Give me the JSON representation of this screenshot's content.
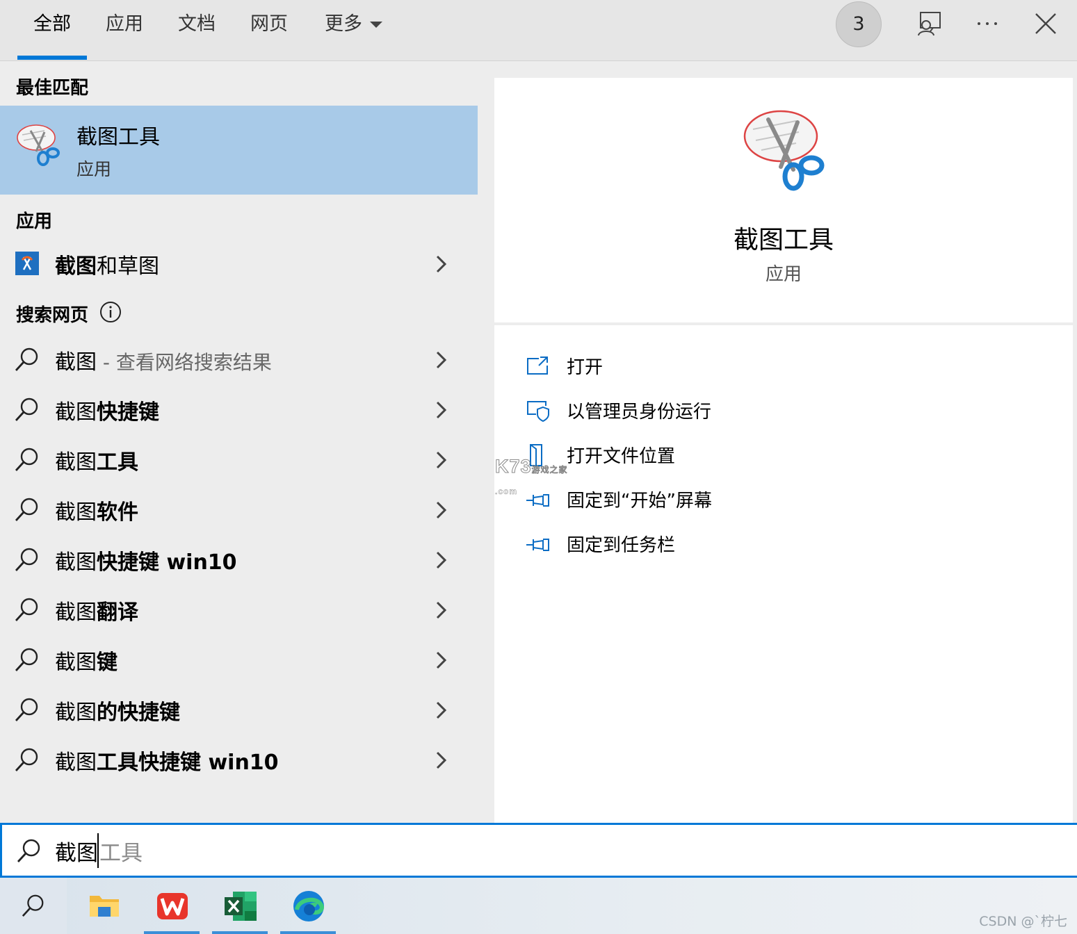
{
  "tabs": [
    {
      "label": "全部",
      "active": true
    },
    {
      "label": "应用",
      "active": false
    },
    {
      "label": "文档",
      "active": false
    },
    {
      "label": "网页",
      "active": false
    },
    {
      "label": "更多",
      "active": false
    }
  ],
  "header_tools": {
    "points": "3",
    "feedback_icon": "feedback-icon",
    "more_icon": "ellipsis-icon",
    "close_icon": "close-icon"
  },
  "left": {
    "best_match_header": "最佳匹配",
    "best_match": {
      "name": "截图工具",
      "type": "应用",
      "icon": "snipping-tool-icon"
    },
    "apps_header": "应用",
    "apps": [
      {
        "name_normal": "",
        "name_bold": "截图",
        "name_rest": "和草图",
        "icon": "snip-sketch-icon"
      }
    ],
    "web_header": "搜索网页",
    "web_results": [
      {
        "prefix": "截图",
        "bold": "",
        "suffix": " - 查看网络搜索结果"
      },
      {
        "prefix": "截图",
        "bold": "快捷键",
        "suffix": ""
      },
      {
        "prefix": "截图",
        "bold": "工具",
        "suffix": ""
      },
      {
        "prefix": "截图",
        "bold": "软件",
        "suffix": ""
      },
      {
        "prefix": "截图",
        "bold": "快捷键 win10",
        "suffix": ""
      },
      {
        "prefix": "截图",
        "bold": "翻译",
        "suffix": ""
      },
      {
        "prefix": "截图",
        "bold": "键",
        "suffix": ""
      },
      {
        "prefix": "截图",
        "bold": "的快捷键",
        "suffix": ""
      },
      {
        "prefix": "截图",
        "bold": "工具快捷键 win10",
        "suffix": ""
      }
    ]
  },
  "right": {
    "name": "截图工具",
    "type": "应用",
    "actions": [
      {
        "label": "打开",
        "icon": "open-icon"
      },
      {
        "label": "以管理员身份运行",
        "icon": "shield-icon"
      },
      {
        "label": "打开文件位置",
        "icon": "file-location-icon"
      },
      {
        "label": "固定到“开始”屏幕",
        "icon": "pin-icon"
      },
      {
        "label": "固定到任务栏",
        "icon": "pin-icon"
      }
    ],
    "watermark": "K73",
    "watermark_sub": "游戏之家 .com"
  },
  "search": {
    "query": "截图",
    "suggestion": "工具"
  },
  "taskbar": {
    "apps": [
      {
        "name": "file-explorer",
        "running": false
      },
      {
        "name": "wps-office",
        "running": true
      },
      {
        "name": "excel",
        "running": true
      },
      {
        "name": "edge",
        "running": true
      }
    ],
    "corner_text": "CSDN @`柠七"
  },
  "colors": {
    "accent": "#0078d7",
    "selected_row": "#a8cae8",
    "panel_bg": "#ededed",
    "detail_bg": "#ffffff"
  }
}
